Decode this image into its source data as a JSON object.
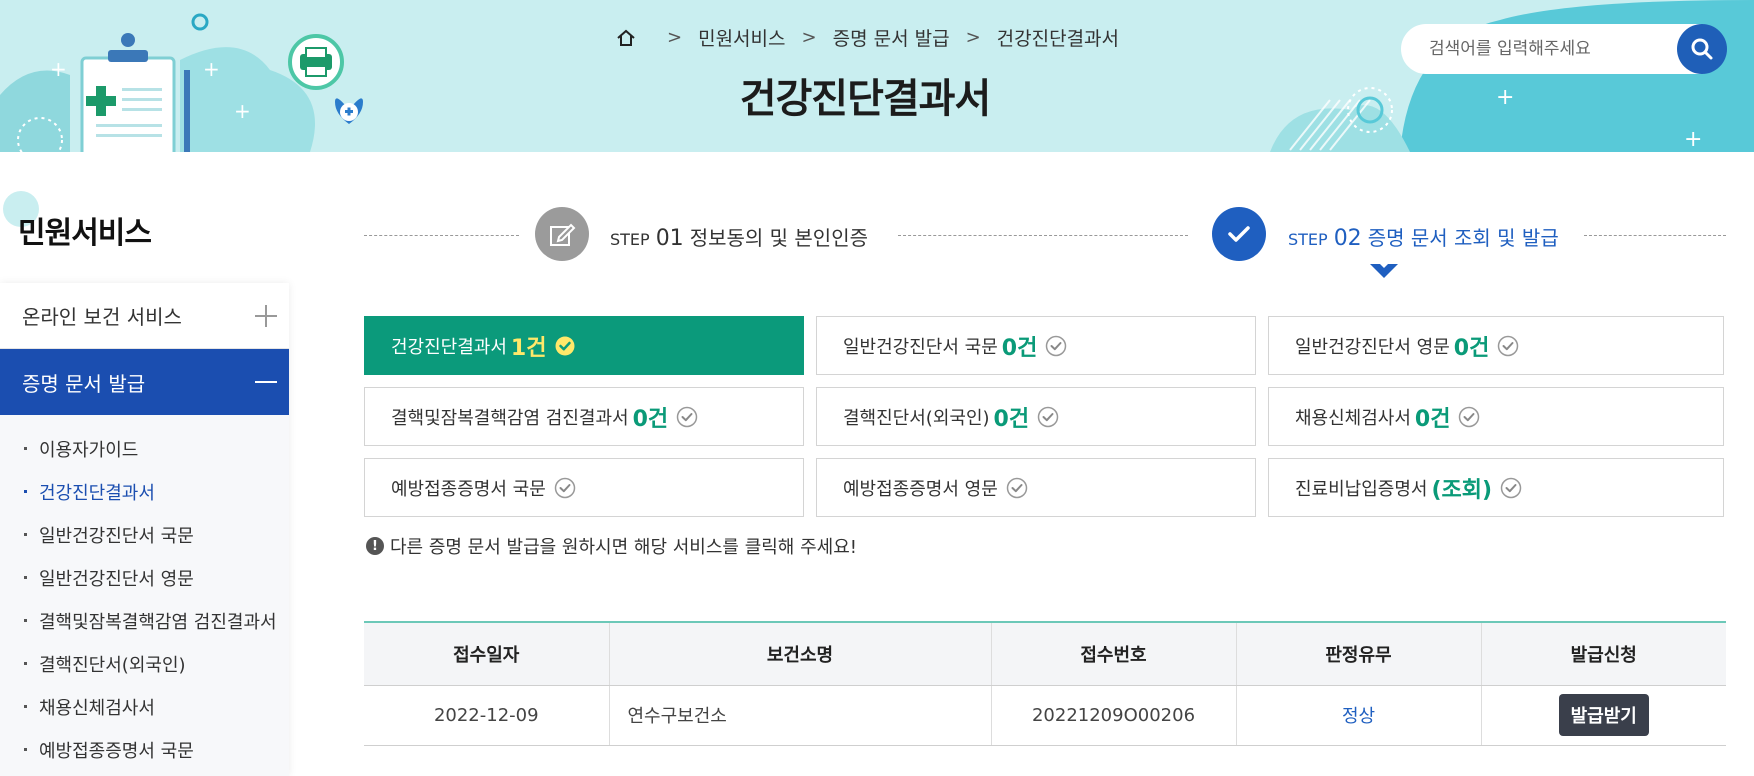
{
  "breadcrumb": [
    "민원서비스",
    "증명 문서 발급",
    "건강진단결과서"
  ],
  "page_title": "건강진단결과서",
  "search": {
    "placeholder": "검색어를 입력해주세요"
  },
  "sidebar": {
    "title": "민원서비스",
    "menus": [
      {
        "label": "온라인 보건 서비스",
        "state": "collapsed"
      },
      {
        "label": "증명 문서 발급",
        "state": "expanded"
      }
    ],
    "items": [
      {
        "label": "이용자가이드"
      },
      {
        "label": "건강진단결과서",
        "active": true
      },
      {
        "label": "일반건강진단서 국문"
      },
      {
        "label": "일반건강진단서 영문"
      },
      {
        "label": "결핵및잠복결핵감염 검진결과서"
      },
      {
        "label": "결핵진단서(외국인)"
      },
      {
        "label": "채용신체검사서"
      },
      {
        "label": "예방접종증명서 국문"
      }
    ]
  },
  "steps": [
    {
      "prefix": "STEP",
      "num": "01",
      "label": "정보동의 및 본인인증",
      "icon": "pencil-icon"
    },
    {
      "prefix": "STEP",
      "num": "02",
      "label": "증명 문서 조회 및 발급",
      "icon": "check-icon",
      "current": true
    }
  ],
  "docs": [
    {
      "label": "건강진단결과서",
      "count": "1건",
      "active": true
    },
    {
      "label": "일반건강진단서 국문",
      "count": "0건"
    },
    {
      "label": "일반건강진단서 영문",
      "count": "0건"
    },
    {
      "label": "결핵및잠복결핵감염 검진결과서",
      "count": "0건"
    },
    {
      "label": "결핵진단서(외국인)",
      "count": "0건"
    },
    {
      "label": "채용신체검사서",
      "count": "0건"
    },
    {
      "label": "예방접종증명서 국문",
      "count": ""
    },
    {
      "label": "예방접종증명서 영문",
      "count": ""
    },
    {
      "label": "진료비납입증명서",
      "count": "(조회)"
    }
  ],
  "notice": "다른 증명 문서 발급을 원하시면 해당 서비스를 클릭해 주세요!",
  "table": {
    "headers": [
      "접수일자",
      "보건소명",
      "접수번호",
      "판정유무",
      "발급신청"
    ],
    "rows": [
      {
        "date": "2022-12-09",
        "center": "연수구보건소",
        "number": "20221209O00206",
        "result": "정상",
        "action": "발급받기"
      }
    ]
  },
  "colors": {
    "banner": "#c9eef0",
    "primary": "#1b4eb0",
    "green": "#0b9a7b",
    "count": "#0a9a78"
  }
}
